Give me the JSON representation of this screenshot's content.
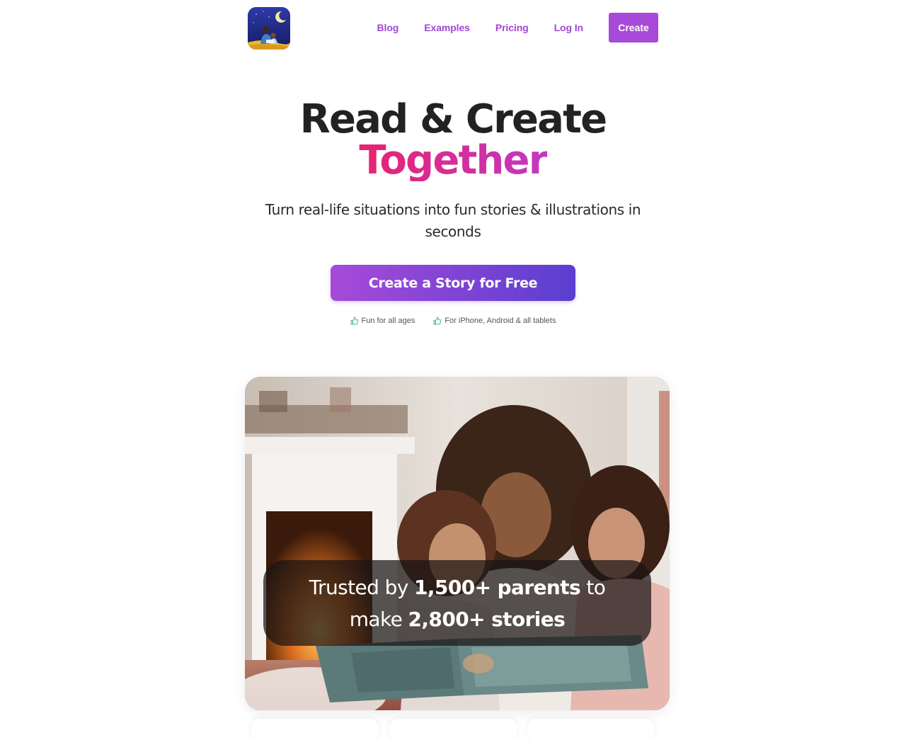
{
  "header": {
    "logo_name": "app-logo",
    "nav": [
      {
        "label": "Blog"
      },
      {
        "label": "Examples"
      },
      {
        "label": "Pricing"
      },
      {
        "label": "Log In"
      }
    ],
    "create_label": "Create"
  },
  "hero": {
    "title_line1": "Read & Create",
    "title_line2": "Together",
    "subtitle": "Turn real-life situations into fun stories & illustrations in seconds",
    "cta_label": "Create a Story for Free",
    "features": [
      {
        "icon": "thumbs-up-icon",
        "label": "Fun for all ages"
      },
      {
        "icon": "thumbs-up-icon",
        "label": "For iPhone, Android & all tablets"
      }
    ]
  },
  "trust": {
    "part1": "Trusted by ",
    "parents": "1,500+ parents",
    "part2": " to",
    "part3": "make ",
    "stories": "2,800+ stories"
  },
  "colors": {
    "accent": "#a74ad9",
    "gradient_start": "#e8236f",
    "gradient_end": "#c238c2",
    "cta_end": "#5a3fd0"
  }
}
